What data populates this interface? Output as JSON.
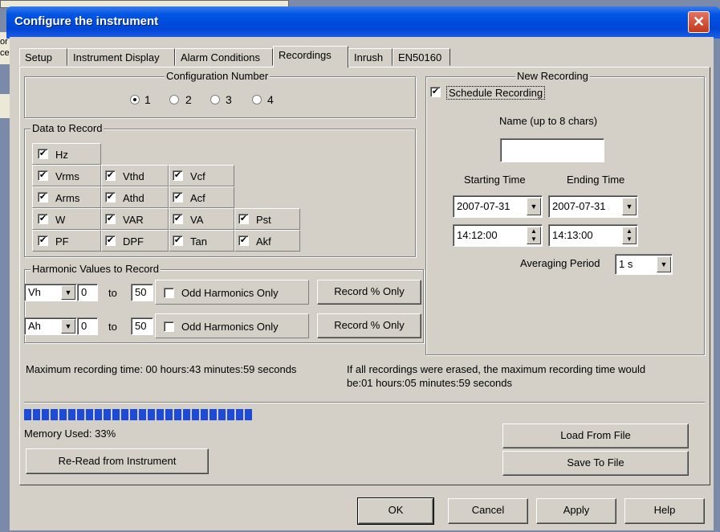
{
  "window": {
    "title": "Configure the instrument"
  },
  "background": {
    "frag1": "or",
    "frag2": "ce"
  },
  "tabs": [
    "Setup",
    "Instrument Display",
    "Alarm Conditions",
    "Recordings",
    "Inrush",
    "EN50160"
  ],
  "active_tab": "Recordings",
  "config": {
    "legend": "Configuration Number",
    "options": [
      "1",
      "2",
      "3",
      "4"
    ],
    "selected": "1"
  },
  "data_to_record": {
    "legend": "Data to Record",
    "items": [
      "Hz",
      "Vrms",
      "Vthd",
      "Vcf",
      "Arms",
      "Athd",
      "Acf",
      "W",
      "VAR",
      "VA",
      "Pst",
      "PF",
      "DPF",
      "Tan",
      "Akf"
    ],
    "check": "✔"
  },
  "harmonics": {
    "legend": "Harmonic Values to Record",
    "rows": [
      {
        "type": "Vh",
        "from": "0",
        "to_label": "to",
        "to": "50",
        "odd_label": "Odd Harmonics Only",
        "record_btn": "Record % Only"
      },
      {
        "type": "Ah",
        "from": "0",
        "to_label": "to",
        "to": "50",
        "odd_label": "Odd Harmonics Only",
        "record_btn": "Record % Only"
      }
    ]
  },
  "new_recording": {
    "legend": "New Recording",
    "schedule_label": "Schedule Recording",
    "name_label": "Name (up to 8 chars)",
    "name_value": "",
    "start_label": "Starting Time",
    "end_label": "Ending Time",
    "start_date": "2007-07-31",
    "end_date": "2007-07-31",
    "start_time": "14:12:00",
    "end_time": "14:13:00",
    "avg_label": "Averaging Period",
    "avg_value": "1 s"
  },
  "info": {
    "max_time": "Maximum recording time: 00 hours:43 minutes:59 seconds",
    "erased_line1": "If all recordings were erased, the maximum recording time would",
    "erased_line2": "be:01 hours:05 minutes:59 seconds"
  },
  "memory": {
    "label": "Memory Used: 33%",
    "used_fraction": 0.33
  },
  "buttons": {
    "reread": "Re-Read from Instrument",
    "load": "Load From File",
    "save": "Save To File",
    "ok": "OK",
    "cancel": "Cancel",
    "apply": "Apply",
    "help": "Help"
  },
  "colors": {
    "title_bar": "#0055e5",
    "progress": "#1e4bd6",
    "dialog_bg": "#d4d0c8"
  }
}
